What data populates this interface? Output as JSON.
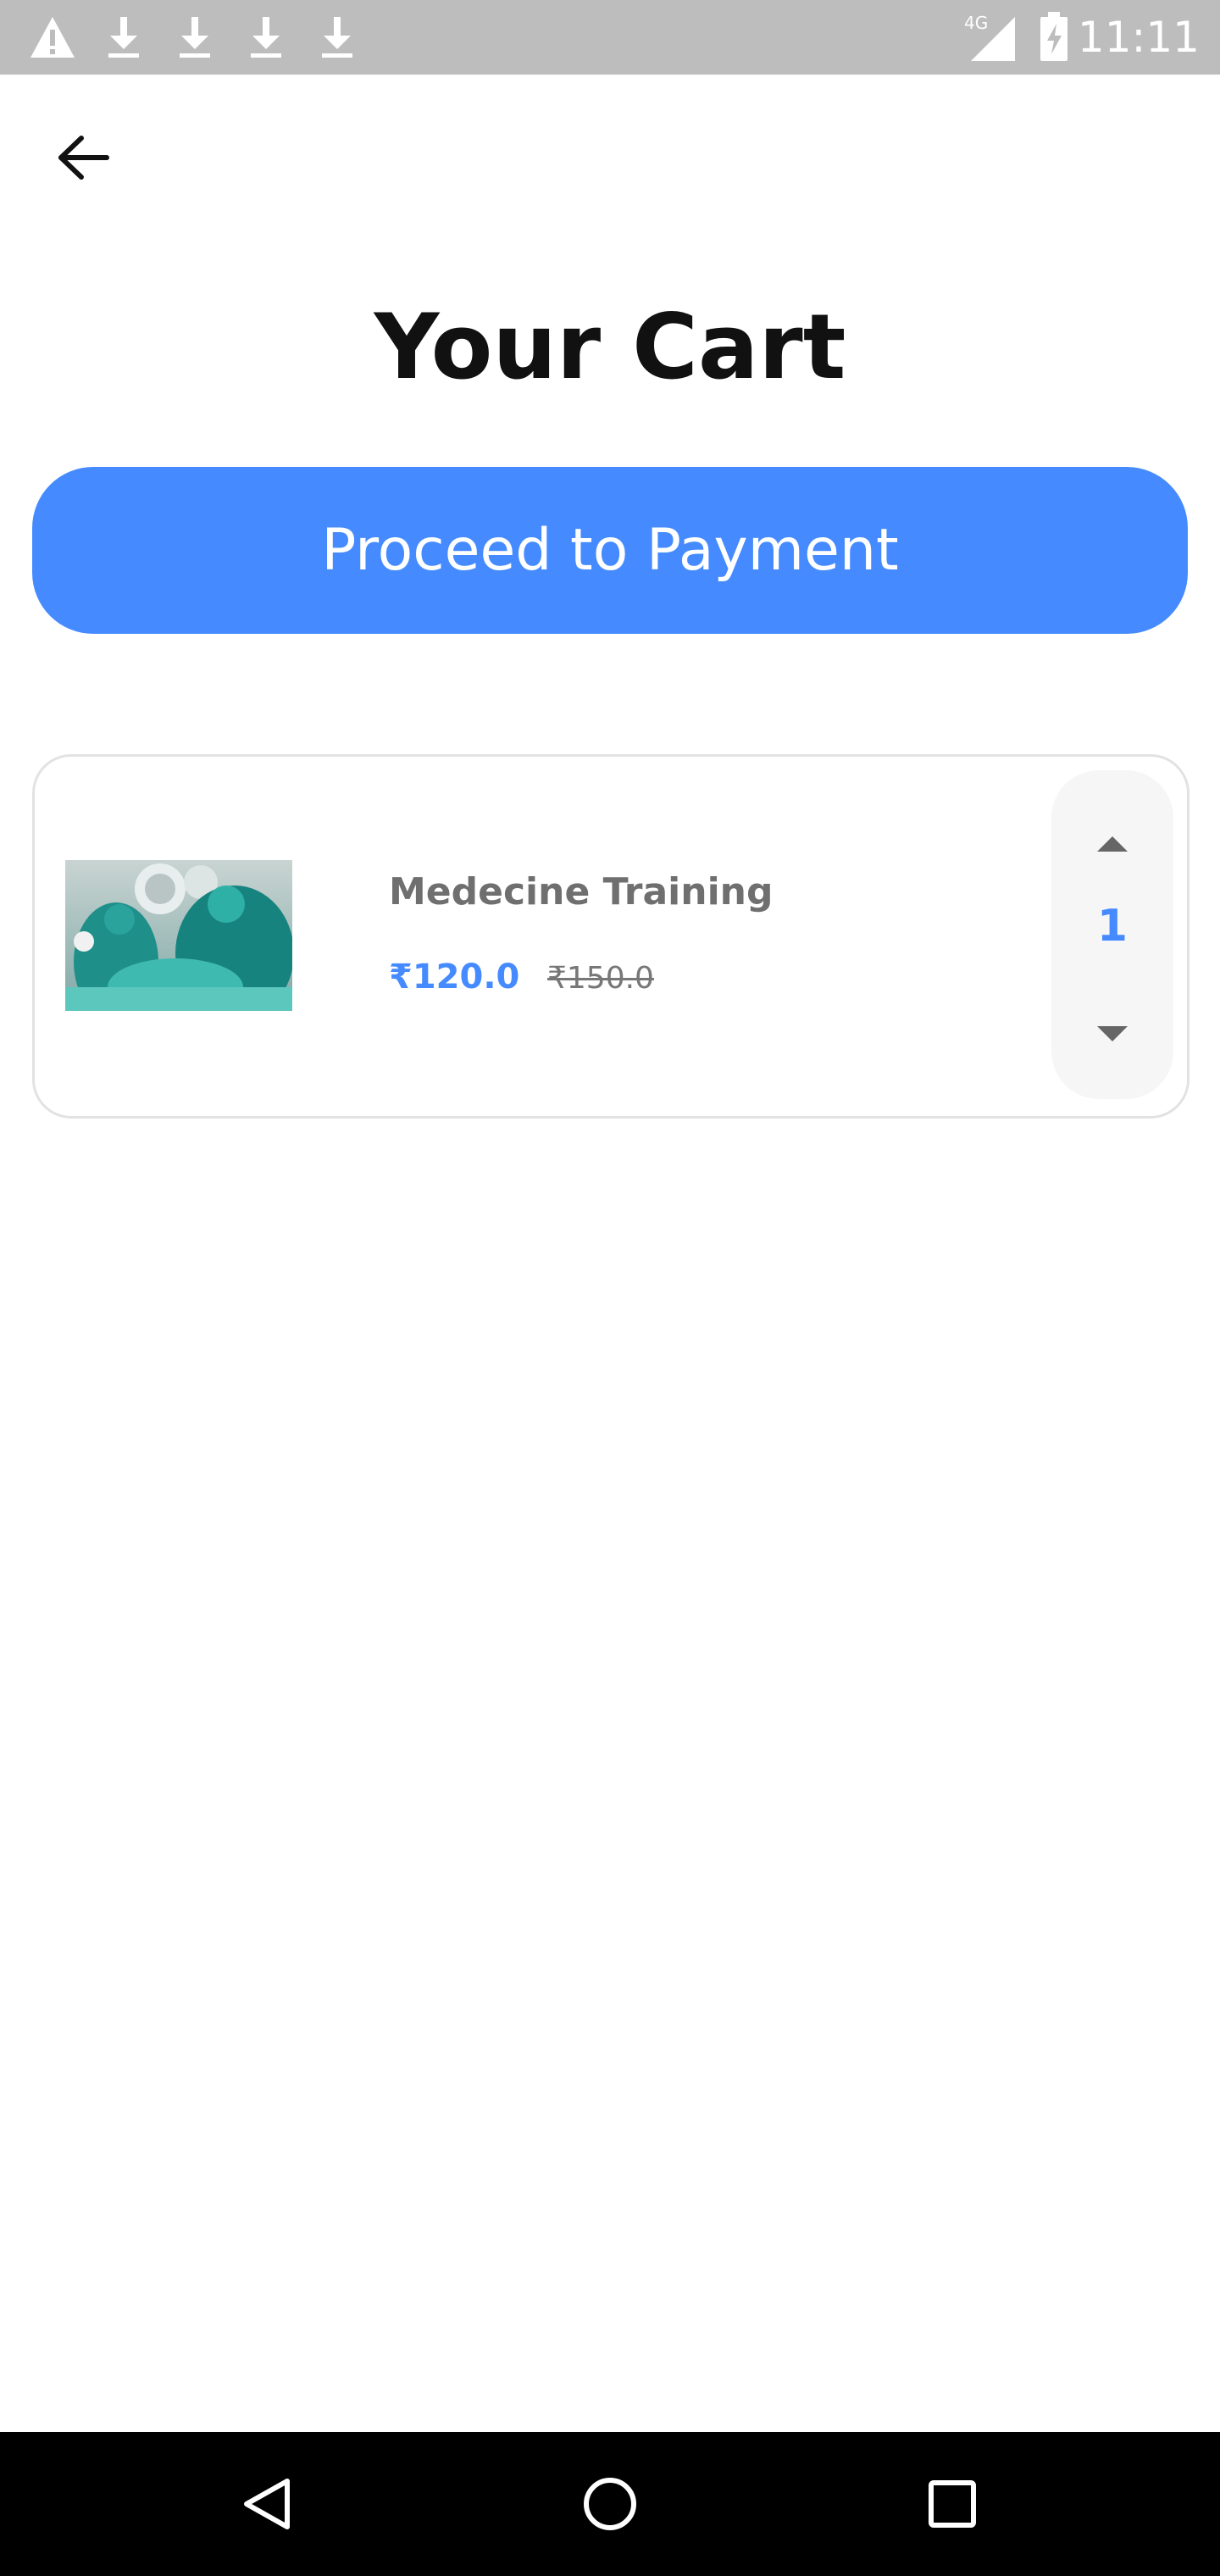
{
  "status_bar": {
    "time": "11:11",
    "network": "4G",
    "notification_icons": [
      "warning-icon",
      "download-icon",
      "download-icon",
      "download-icon",
      "download-icon"
    ]
  },
  "header": {
    "back_icon": "arrow-left-icon"
  },
  "page": {
    "title": "Your Cart",
    "proceed_label": "Proceed to Payment"
  },
  "cart": {
    "items": [
      {
        "name": "Medecine Training",
        "price": "₹120.0",
        "original_price": "₹150.0",
        "quantity": "1"
      }
    ]
  },
  "colors": {
    "accent": "#458bff",
    "status_bar": "#bdbdbd",
    "nav_bar": "#000000",
    "title_text": "#111111",
    "muted_text": "#6f6f6f"
  },
  "nav_bar": {
    "buttons": [
      "back-triangle-icon",
      "home-circle-icon",
      "recents-square-icon"
    ]
  }
}
